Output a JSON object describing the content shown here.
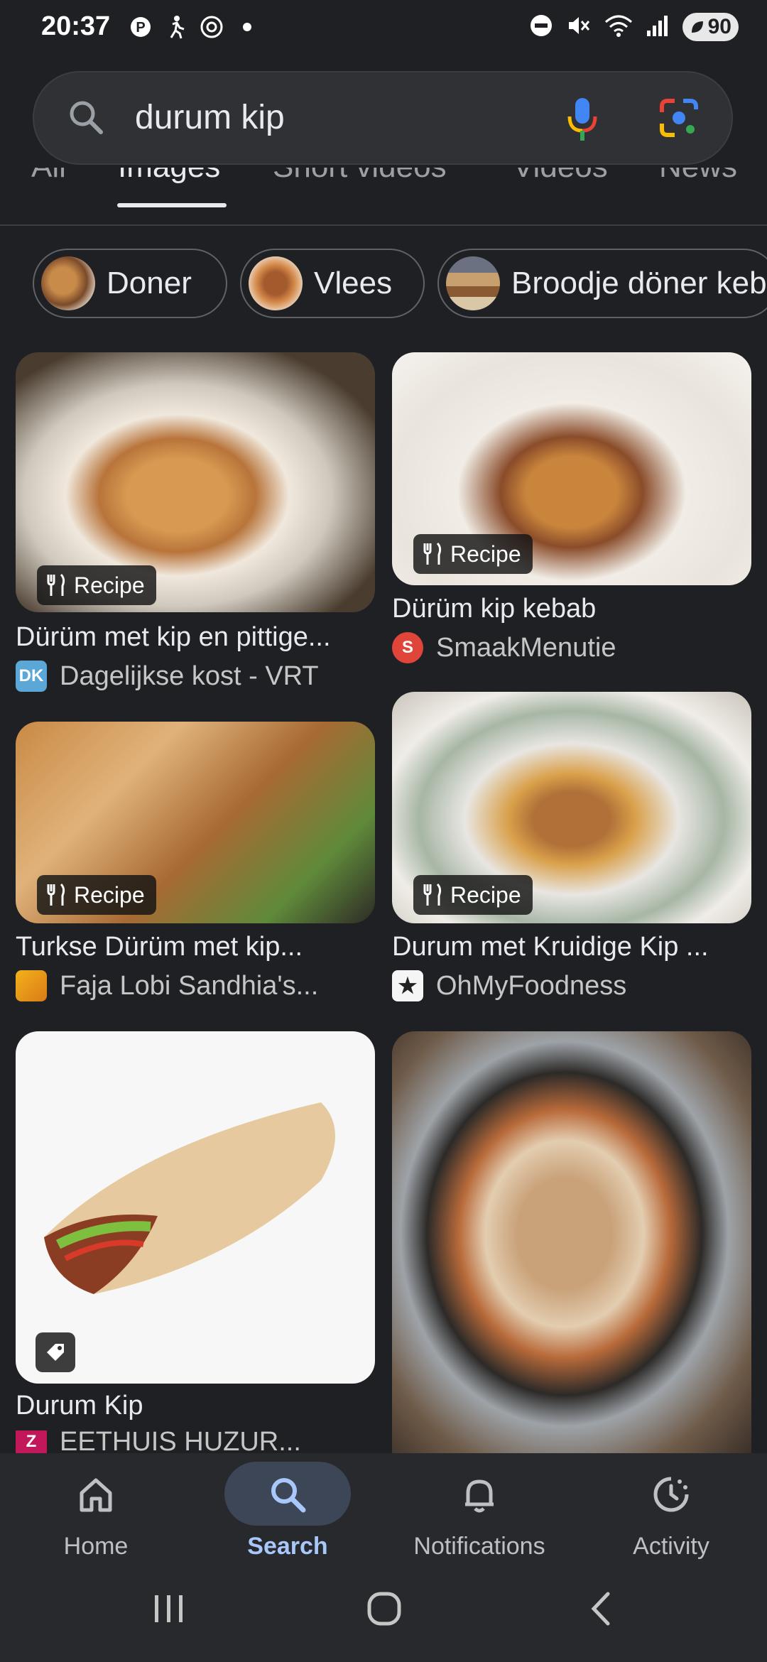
{
  "status": {
    "time": "20:37",
    "battery": "90",
    "icons_left": [
      "pinterest-icon",
      "accessibility-icon",
      "threads-icon",
      "dot-icon"
    ],
    "icons_right": [
      "dnd-icon",
      "mute-icon",
      "wifi-icon",
      "signal-icon"
    ]
  },
  "search": {
    "query": "durum kip"
  },
  "tabs": [
    {
      "label": "All"
    },
    {
      "label": "Images",
      "active": true
    },
    {
      "label": "Short videos"
    },
    {
      "label": "Videos"
    },
    {
      "label": "News"
    }
  ],
  "chips": [
    {
      "label": "Doner"
    },
    {
      "label": "Vlees"
    },
    {
      "label": "Broodje döner kebab"
    }
  ],
  "results": [
    {
      "title": "Dürüm met kip en pittige...",
      "source": "Dagelijkse kost - VRT",
      "badge": "Recipe",
      "favicon": "DK"
    },
    {
      "title": "Dürüm kip kebab",
      "source": "SmaakMenutie",
      "badge": "Recipe",
      "favicon": "S"
    },
    {
      "title": "Turkse Dürüm met kip...",
      "source": "Faja Lobi Sandhia's...",
      "badge": "Recipe",
      "favicon": ""
    },
    {
      "title": "Durum met Kruidige Kip ...",
      "source": "OhMyFoodness",
      "badge": "Recipe",
      "favicon": "★"
    },
    {
      "title": "Durum Kip",
      "source": "EETHUIS HUZUR...",
      "badge": "",
      "favicon": "Z"
    }
  ],
  "bottom_nav": [
    {
      "label": "Home",
      "icon": "home-icon"
    },
    {
      "label": "Search",
      "icon": "search-icon",
      "active": true
    },
    {
      "label": "Notifications",
      "icon": "bell-icon"
    },
    {
      "label": "Activity",
      "icon": "activity-icon"
    }
  ],
  "colors": {
    "background": "#1f2023",
    "search_bar": "#303134",
    "active_nav": "#a8c7fa",
    "active_pill": "#3d4656"
  }
}
